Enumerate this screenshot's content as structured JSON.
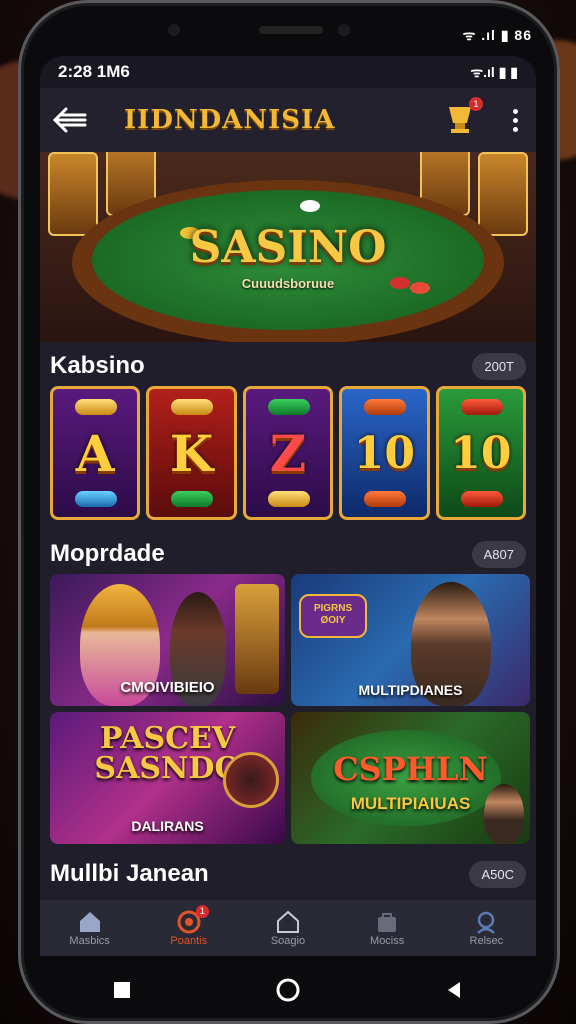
{
  "phone_status": {
    "text": "ᯤ .ıl ▮ 86"
  },
  "status": {
    "time": "2:28  1M6",
    "icons": "ᯤ.ıl ▮ ▮"
  },
  "appbar": {
    "title": "IIDNDANISIA",
    "notif_count": "1"
  },
  "hero": {
    "title": "SASINO",
    "subtitle": "Cuuudsboruue"
  },
  "sections": [
    {
      "title": "Kabsino",
      "count": "200T"
    },
    {
      "title": "Moprdade",
      "count": "A807"
    },
    {
      "title": "Mullbi Janean",
      "count": "A50C"
    }
  ],
  "slots": [
    {
      "symbol": "A",
      "bg": "#4a1a6e"
    },
    {
      "symbol": "K",
      "bg": "#9a1a1a"
    },
    {
      "symbol": "Z",
      "bg": "#4a1a6e"
    },
    {
      "symbol": "10",
      "bg": "#1a4fa0"
    },
    {
      "symbol": "10",
      "bg": "#1e7a30"
    }
  ],
  "cards": [
    {
      "label": "CMOIVIBIEIO"
    },
    {
      "label": "MULTIPDIANES",
      "badge": "PIGRNS ØOIY"
    },
    {
      "label": "DALIRANS",
      "title": "PASCEV SASNDO"
    },
    {
      "label": "MULTIPIAIUAS",
      "title": "CSPHLN"
    }
  ],
  "bottom_nav": [
    {
      "label": "Masbics",
      "icon": "home-icon",
      "active": false
    },
    {
      "label": "Poantis",
      "icon": "chip-icon",
      "active": true,
      "badge": "1"
    },
    {
      "label": "Soagio",
      "icon": "home-outline-icon",
      "active": false
    },
    {
      "label": "Mociss",
      "icon": "bag-icon",
      "active": false
    },
    {
      "label": "Relsec",
      "icon": "search-icon",
      "active": false
    }
  ],
  "colors": {
    "accent": "#f3b936",
    "active_nav": "#e0542a",
    "screen_bg": "#1f1e2a"
  }
}
